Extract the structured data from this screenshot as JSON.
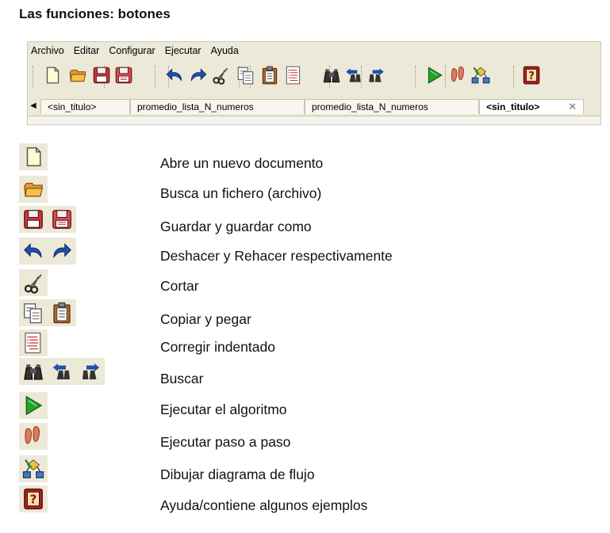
{
  "heading": "Las funciones: botones",
  "menu": [
    "Archivo",
    "Editar",
    "Configurar",
    "Ejecutar",
    "Ayuda"
  ],
  "toolbar_icons": [
    "new-document-icon",
    "open-folder-icon",
    "save-icon",
    "save-as-icon",
    "undo-icon",
    "redo-icon",
    "scissors-icon",
    "copy-icon",
    "paste-icon",
    "indent-icon",
    "binoculars-icon",
    "find-previous-icon",
    "find-next-icon",
    "play-icon",
    "footsteps-icon",
    "flowchart-icon",
    "help-book-icon"
  ],
  "tabs": [
    {
      "label": "<sin_titulo>",
      "active": false
    },
    {
      "label": "promedio_lista_N_numeros",
      "active": false
    },
    {
      "label": "promedio_lista_N_numeros",
      "active": false
    },
    {
      "label": "<sin_titulo>",
      "active": true
    }
  ],
  "functions": [
    {
      "icons": [
        "new-document-icon"
      ],
      "text": "Abre un nuevo documento"
    },
    {
      "icons": [
        "open-folder-icon"
      ],
      "text": "Busca un fichero (archivo)"
    },
    {
      "icons": [
        "save-icon",
        "save-as-icon"
      ],
      "text": "Guardar y guardar como"
    },
    {
      "icons": [
        "undo-icon",
        "redo-icon"
      ],
      "text": "Deshacer y Rehacer respectivamente"
    },
    {
      "icons": [
        "scissors-icon"
      ],
      "text": "Cortar"
    },
    {
      "icons": [
        "copy-icon",
        "paste-icon"
      ],
      "text": "Copiar y pegar"
    },
    {
      "icons": [
        "indent-icon"
      ],
      "text": "Corregir indentado"
    },
    {
      "icons": [
        "binoculars-icon",
        "find-previous-icon",
        "find-next-icon"
      ],
      "text": "Buscar"
    },
    {
      "icons": [
        "play-icon"
      ],
      "text": "Ejecutar el algoritmo"
    },
    {
      "icons": [
        "footsteps-icon"
      ],
      "text": "Ejecutar paso a paso"
    },
    {
      "icons": [
        "flowchart-icon"
      ],
      "text": "Dibujar diagrama de flujo"
    },
    {
      "icons": [
        "help-book-icon"
      ],
      "text": "Ayuda/contiene algunos ejemplos"
    }
  ],
  "colors": {
    "toolbar_bg": "#ece9d8",
    "undo_blue": "#1f4fa8",
    "play_green": "#22a32a",
    "save_red": "#c8363a",
    "folder_orange": "#e59a2e"
  }
}
